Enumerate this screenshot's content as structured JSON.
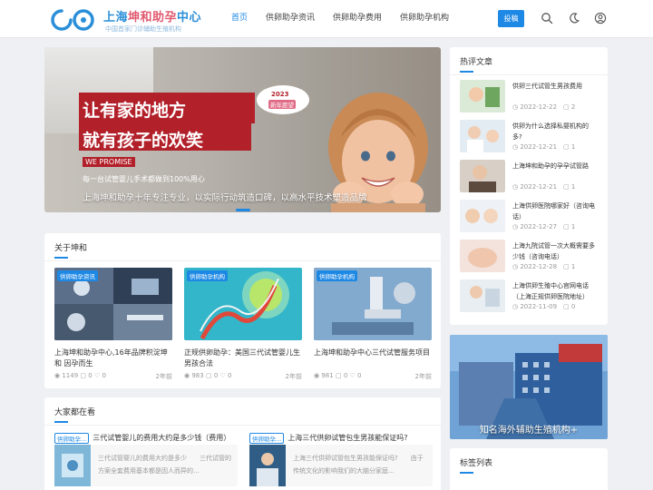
{
  "header": {
    "logo_title_a": "上海",
    "logo_title_b": "坤和助孕",
    "logo_title_c": "中心",
    "logo_sub": "中国首家门诊辅助生殖机构",
    "nav": [
      "首页",
      "供卵助孕资讯",
      "供卵助孕费用",
      "供卵助孕机构"
    ],
    "submit_label": "投稿",
    "accent": "#1e88e5"
  },
  "banner": {
    "headline_1": "让有家的地方",
    "headline_2": "就有孩子的欢笑",
    "promise": "WE   PROMISE",
    "promise_line": "每一台试管婴儿手术都做到100%用心",
    "caption": "上海坤和助孕十年专注专业，以实际行动筑造口碑，以高水平技术塑造品牌",
    "bubble_year": "2023",
    "bubble_text": "新年愿望"
  },
  "about": {
    "title": "关于坤和",
    "items": [
      {
        "tag": "供卵助孕资讯",
        "text": "上海坤和助孕中心,16年品牌积淀坤和 因孕而生",
        "views": "1149",
        "comments": "0",
        "likes": "0",
        "ago": "2年前"
      },
      {
        "tag": "供卵助孕机构",
        "text": "正规供卵助孕：美国三代试管婴儿生男孩合法",
        "views": "983",
        "comments": "0",
        "likes": "0",
        "ago": "2年前"
      },
      {
        "tag": "供卵助孕机构",
        "text": "上海坤和助孕中心三代试管服务项目",
        "views": "981",
        "comments": "0",
        "likes": "0",
        "ago": "2年前"
      }
    ]
  },
  "watching": {
    "title": "大家都在看",
    "items": [
      {
        "tag": "供卵助孕...",
        "title": "三代试管婴儿的费用大约是多少钱（费用）",
        "excerpt": "三代试管婴儿的费用大约是多少　　三代试管的方案全套费用基本都是因人而异的..."
      },
      {
        "tag": "供卵助孕...",
        "title": "上海三代供卵试管包生男孩能保证吗?",
        "excerpt": "上海三代供卵试管包生男孩能保证吗?　　由于传统文化的影响我们的大脑分家庭..."
      }
    ]
  },
  "hot": {
    "title": "热评文章",
    "items": [
      {
        "title": "供卵三代试管生男孩费用",
        "date": "2022-12-22",
        "comments": "2"
      },
      {
        "title": "供卵为什么选择私婴机构的多?",
        "date": "2022-12-21",
        "comments": "1"
      },
      {
        "title": "上海坤和助孕的孕孕试管路",
        "date": "2022-12-21",
        "comments": "1"
      },
      {
        "title": "上海供卵医院哪家好（咨询电话）",
        "date": "2022-12-27",
        "comments": "1"
      },
      {
        "title": "上海九院试管一次大概需要多少钱（咨询电话）",
        "date": "2022-12-28",
        "comments": "1"
      },
      {
        "title": "上海供卵生殖中心官网电话（上海正规供卵医院地址）",
        "date": "2022-11-09",
        "comments": "0"
      }
    ]
  },
  "ad": {
    "text": "知名海外辅助生殖机构+"
  },
  "tags": {
    "title": "标签列表"
  }
}
